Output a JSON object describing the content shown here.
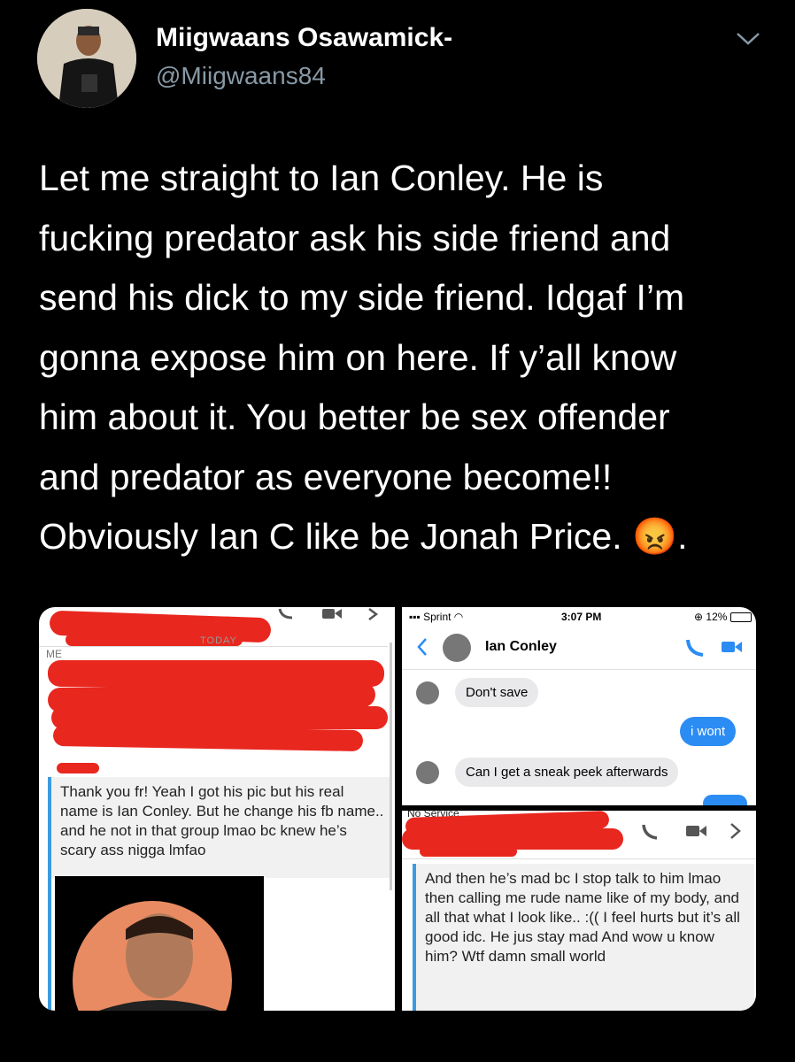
{
  "tweet": {
    "author_name": "Miigwaans Osawamick-",
    "handle": "@Miigwaans84",
    "lines": [
      "Let me straight to Ian Conley. He is",
      "fucking predator ask his side friend and",
      "send his dick to my side friend. Idgaf I’m",
      "gonna expose him on here. If y’all know",
      "him about it. You better be sex offender",
      "and predator as everyone  become!!",
      "Obviously Ian C like be Jonah Price."
    ],
    "emoji_tail": "😡.",
    "icons": [
      "chevron-down-icon"
    ]
  },
  "media": {
    "left": {
      "today_label": "TODAY",
      "me_label": "ME",
      "message": "Thank you fr! Yeah I got his pic but his real name is Ian Conley. But he change his fb name.. and he not in that group lmao bc knew he’s scary ass nigga lmfao"
    },
    "top_right": {
      "carrier": "Sprint",
      "time": "3:07 PM",
      "battery": "12%",
      "contact": "Ian Conley",
      "messages": [
        {
          "from": "them",
          "text": "Don't save"
        },
        {
          "from": "me",
          "text": "i wont"
        },
        {
          "from": "them",
          "text": "Can I get a sneak peek afterwards"
        }
      ],
      "partial_status": "No Service"
    },
    "bottom_right": {
      "message": "And then he’s mad bc I stop talk to him lmao then calling me rude name like of my body, and all that what I look like.. :(( I feel hurts but it’s all good idc. He jus stay mad And wow u know him? Wtf damn small world"
    },
    "colors": {
      "redaction": "#e8271e",
      "ios_blue": "#2b8cf4",
      "fb_blue": "#3b9be0"
    }
  }
}
